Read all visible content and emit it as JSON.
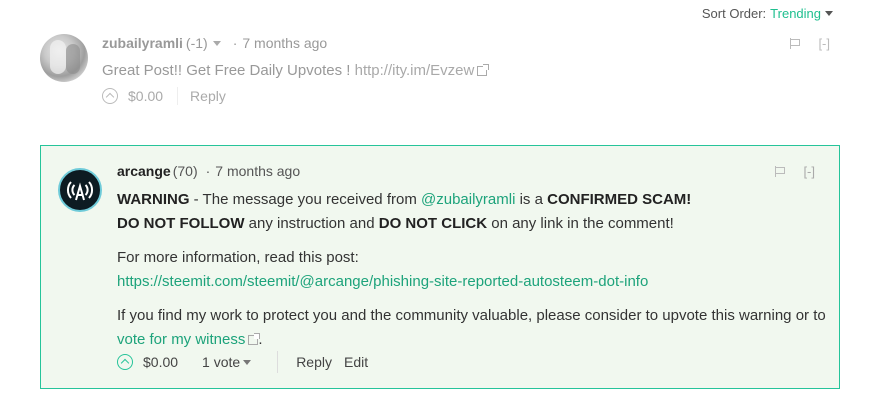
{
  "sort": {
    "label": "Sort Order:",
    "value": "Trending"
  },
  "comment1": {
    "author": "zubailyramli",
    "reputation": "(-1)",
    "dot": "·",
    "age": "7 months ago",
    "body_text": "Great Post!! Get Free Daily Upvotes !",
    "body_link": "http://ity.im/Evzew",
    "payout": "$0.00",
    "reply_label": "Reply",
    "collapse_label": "[-]"
  },
  "comment2": {
    "author": "arcange",
    "reputation": "(70)",
    "dot": "·",
    "age": "7 months ago",
    "collapse_label": "[-]",
    "line1_bold": "WARNING",
    "line1_text": " - The message you received from ",
    "line1_mention": "@zubailyramli",
    "line1_text2": " is a ",
    "line1_bold2": "CONFIRMED SCAM!",
    "line2_bold": "DO NOT FOLLOW",
    "line2_text": " any instruction and ",
    "line2_bold2": "DO NOT CLICK",
    "line2_text2": " on any link in the comment!",
    "info_text": "For more information, read this post:",
    "info_link": "https://steemit.com/steemit/@arcange/phishing-site-reported-autosteem-dot-info",
    "support_text": "If you find my work to protect you and the community valuable, please consider to upvote this warning or to ",
    "support_link": "vote for my witness",
    "support_end": ".",
    "payout": "$0.00",
    "votes": "1 vote",
    "reply_label": "Reply",
    "edit_label": "Edit"
  },
  "colors": {
    "accent": "#26c49a",
    "box_bg": "#f1f8ef",
    "link": "#1da37b"
  },
  "icons": [
    "caret-down-icon",
    "flag-icon",
    "upvote-icon",
    "external-link-icon",
    "avatar-antenna-icon"
  ]
}
